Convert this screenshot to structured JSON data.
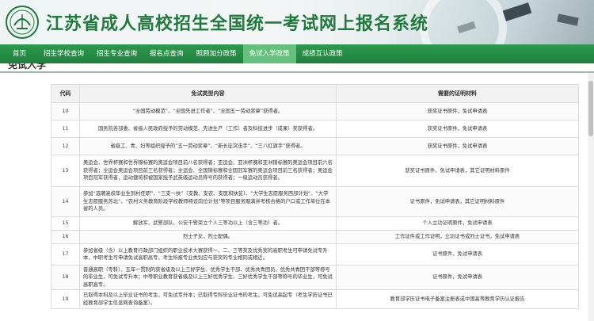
{
  "header": {
    "title": "江苏省成人高校招生全国统一考试网上报名系统",
    "accent_color": "#1f7a3c"
  },
  "nav": {
    "items": [
      {
        "label": "首页",
        "active": false
      },
      {
        "label": "招生学校查询",
        "active": false
      },
      {
        "label": "招生专业查询",
        "active": false
      },
      {
        "label": "报名点查询",
        "active": false
      },
      {
        "label": "照顾加分政策",
        "active": false
      },
      {
        "label": "免试入学政策",
        "active": true
      },
      {
        "label": "成绩互认政策",
        "active": false
      }
    ],
    "bar_color": "#1f7f3d",
    "active_color": "#66c07d"
  },
  "section": {
    "title": "免试入学"
  },
  "table": {
    "headers": {
      "code": "代码",
      "type": "免试类型内容",
      "proof": "需要的证明材料"
    },
    "rows": [
      {
        "code": "10",
        "type": "“全国劳动模范”、“全国先进工作者”、“全国五一劳动奖章”获得者。",
        "proof": "获奖证书原件，免试申请表",
        "align": "center"
      },
      {
        "code": "11",
        "type": "国务院各部委、省级人民政府授予的劳动模范、先进生产（工作）者及科技进步（成果）奖获得者。",
        "proof": "获奖证书原件，免试申请表",
        "align": "center"
      },
      {
        "code": "12",
        "type": "省级工、青、妇等组织授予的“五一劳动奖章”、“新长征突击手”、“三八红旗手”获得者。",
        "proof": "获奖证书原件，免试申请表",
        "align": "center"
      },
      {
        "code": "13",
        "type": "奥运会、世界杯赛和世界锦标赛的奥运会项目前八名获得者；亚运会、亚洲杯赛和亚洲锦标赛的奥运会项目前六名获得者；全运会奥运会项目前三名获得者；全运会、全国锦标赛和全国冠军赛的奥运会项目前三名获得者；奥运会项目冠军获得者，运动健将和被国家授予武英级运动员称号的获得者；一级运动员获得者。",
        "proof": "获奖证书原件，免试申请表，其它证明材料原件",
        "align": "left"
      },
      {
        "code": "14",
        "type": "参加“选聘高校毕业生到村任职”、“三支一扶”（支教、支农、支医和扶贫）、“大学生志愿服务西部计划”、“大学生志愿服务苏北”、“农村义务教育阶段学校教师特设岗位计划”等项目服务期满并考核合格的户口或工作单位在本省的人员。",
        "proof": "证书原件，免试申请表，其它证明材料原件",
        "align": "left"
      },
      {
        "code": "15",
        "type": "解放军、武警部队、公安干警荣立个人三等功以上（含三等功）者。",
        "proof": "个人立功证明原件，免试申请表",
        "align": "center"
      },
      {
        "code": "16",
        "type": "烈士子女，烈士配偶。",
        "proof": "工作证件或工作证明，立功证书或烈士证书，免试申请表",
        "align": "center"
      },
      {
        "code": "17",
        "type": "参加省级（含）以上教育行政部门组织的职业技术大赛获得一、二、三等奖及优秀奖的高职考生可申请免试专升本，中职考生可申请免试高职高专。考生所报专业类别应与获奖的专业相同或相近。",
        "proof": "证书原件，免试申请表",
        "align": "left"
      },
      {
        "code": "18",
        "type": "普通高职（专科）、五年一贯制的获省级及以上三好学生、优秀学生干部、优秀共青团员、优秀共青团干部等称号的毕业生，可免试专升本；中等职业教育获省级及以上三好优秀学生、三好优秀学生干部等称号的毕业生，可免试高职高专。",
        "proof": "证书原件，免试申请表",
        "align": "left"
      },
      {
        "code": "19",
        "type": "已取得本科及以上毕业证书的考生，可免试专升本；已取得专科毕业证书的考生，可免试高起专（考生学历证书已经教育部学生信息网查询备案）。",
        "proof": "教育部学历证书电子备案注册表或中国高等教育学历认证报告",
        "align": "left"
      }
    ]
  }
}
